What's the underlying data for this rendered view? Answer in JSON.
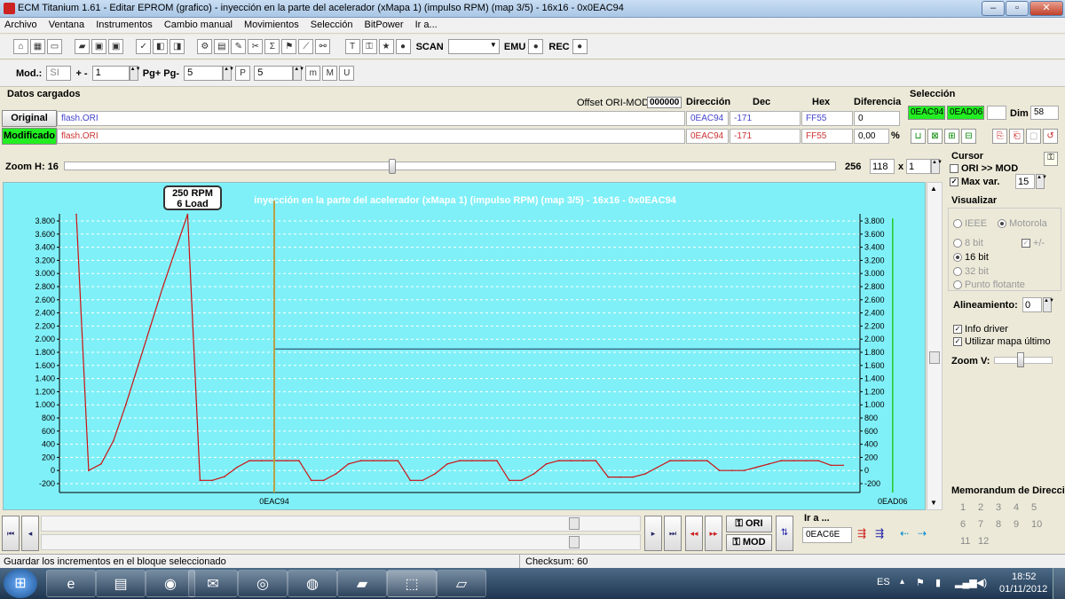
{
  "window": {
    "title": "ECM Titanium 1.61 - Editar EPROM (grafico) - inyección en la parte del acelerador (xMapa 1) (impulso RPM) (map 3/5) - 16x16 - 0x0EAC94"
  },
  "menu": [
    "Archivo",
    "Ventana",
    "Instrumentos",
    "Cambio manual",
    "Movimientos",
    "Selección",
    "BitPower",
    "Ir a..."
  ],
  "toolbar1": {
    "scan_label": "SCAN",
    "emu_label": "EMU",
    "rec_label": "REC"
  },
  "toolbar2": {
    "mod_label": "Mod.:",
    "mod_value": "SI",
    "plusminus_label": "+ -",
    "plusminus_value": "1",
    "pg_label": "Pg+ Pg-",
    "pg_value": "5",
    "p_value": "5"
  },
  "datos": {
    "title": "Datos cargados",
    "offset_label": "Offset ORI-MOD",
    "offset_value": "000000",
    "col_direccion": "Dirección",
    "col_dec": "Dec",
    "col_hex": "Hex",
    "col_diferencia": "Diferencia",
    "original": {
      "label": "Original",
      "file": "flash.ORI",
      "dir": "0EAC94",
      "dec": "-171",
      "hex": "FF55",
      "dif": "0"
    },
    "modificado": {
      "label": "Modificado",
      "file": "flash.ORI",
      "dir": "0EAC94",
      "dec": "-171",
      "hex": "FF55",
      "dif": "0,00",
      "unit": "%"
    }
  },
  "seleccion": {
    "title": "Selección",
    "start": "0EAC94",
    "end": "0EAD06",
    "dim_label": "Dim",
    "dim_value": "58"
  },
  "zoom": {
    "label": "Zoom H: 16",
    "max": "256",
    "value": "118",
    "x_label": "x",
    "mult": "1"
  },
  "chart": {
    "title": "inyección en la parte del acelerador (xMapa 1) (impulso RPM) (map 3/5) - 16x16 - 0x0EAC94",
    "tooltip_line1": "250 RPM",
    "tooltip_line2": "6 Load",
    "x_label_left": "0EAC94",
    "x_label_right": "0EAD06"
  },
  "chart_data": {
    "type": "line",
    "title": "inyección en la parte del acelerador (xMapa 1) (impulso RPM) (map 3/5) - 16x16 - 0x0EAC94",
    "ylim": [
      -200,
      3800
    ],
    "yticks": [
      "3.800",
      "3.600",
      "3.400",
      "3.200",
      "3.000",
      "2.800",
      "2.600",
      "2.400",
      "2.200",
      "2.000",
      "1.800",
      "1.600",
      "1.400",
      "1.200",
      "1.000",
      "800",
      "600",
      "400",
      "200",
      "0",
      "-200"
    ],
    "ytick_values": [
      3800,
      3600,
      3400,
      3200,
      3000,
      2800,
      2600,
      2400,
      2200,
      2000,
      1800,
      1600,
      1400,
      1200,
      1000,
      800,
      600,
      400,
      200,
      0,
      -200
    ],
    "x_labels": [
      "0EAC94",
      "0EAD06"
    ],
    "x_label_index": [
      16,
      66
    ],
    "grid": true,
    "series": [
      {
        "values": [
          3900,
          0,
          100,
          450,
          1000,
          1600,
          2200,
          2800,
          3350,
          3900,
          -150,
          -150,
          -90,
          50,
          150,
          150,
          150,
          150,
          150,
          -150,
          -150,
          -50,
          100,
          150,
          150,
          150,
          150,
          -150,
          -150,
          -50,
          100,
          150,
          150,
          150,
          150,
          -150,
          -150,
          -50,
          100,
          150,
          150,
          150,
          150,
          -100,
          -100,
          -100,
          -50,
          50,
          150,
          150,
          150,
          150,
          0,
          0,
          0,
          50,
          100,
          150,
          150,
          150,
          150,
          80,
          80
        ]
      }
    ],
    "selection_value": 1850,
    "marker_index": 16,
    "cursor_index": 66
  },
  "nav": {
    "ori_label": "ORI",
    "mod_label": "MOD",
    "ira_label": "Ir a ...",
    "ira_value": "0EAC6E"
  },
  "panel": {
    "cursor_label": "Cursor",
    "ori_mod_label": "ORI >> MOD",
    "maxvar_label": "Max var.",
    "maxvar_value": "15",
    "visualizar_label": "Visualizar",
    "ieee_label": "IEEE",
    "motorola_label": "Motorola",
    "bit8_label": "8 bit",
    "signed_label": "+/-",
    "bit16_label": "16 bit",
    "bit32_label": "32 bit",
    "float_label": "Punto flotante",
    "align_label": "Alineamiento:",
    "align_value": "0",
    "info_driver_label": "Info driver",
    "utilizar_label": "Utilizar mapa último",
    "zoomv_label": "Zoom V:",
    "memo_label": "Memorandum de Direcciones",
    "memo_numbers": [
      "1",
      "2",
      "3",
      "4",
      "5",
      "6",
      "7",
      "8",
      "9",
      "10",
      "11",
      "12"
    ]
  },
  "status": {
    "message": "Guardar los incrementos en el bloque seleccionado",
    "checksum": "Checksum: 60"
  },
  "taskbar": {
    "lang": "ES",
    "time": "18:52",
    "date": "01/11/2012"
  }
}
